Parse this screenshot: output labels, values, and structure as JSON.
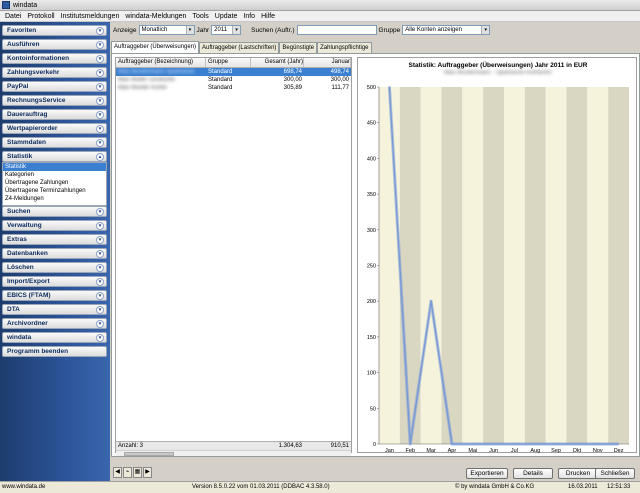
{
  "window": {
    "title": "windata"
  },
  "menu": [
    "Datei",
    "Protokoll",
    "Institutsmeldungen",
    "windata-Meldungen",
    "Tools",
    "Update",
    "Info",
    "Hilfe"
  ],
  "sidebar": {
    "items_top": [
      "Favoriten",
      "Ausführen",
      "Kontoinformationen",
      "Zahlungsverkehr",
      "PayPal",
      "RechnungsService",
      "Dauerauftrag",
      "Wertpapierorder",
      "Stammdaten",
      "Statistik"
    ],
    "statistik_sub": [
      "Statistik",
      "Kategorien",
      "Übertragene Zahlungen",
      "Übertragene Terminzahlungen",
      "Z4-Meldungen"
    ],
    "items_bottom": [
      "Suchen",
      "Verwaltung",
      "Extras",
      "Datenbanken",
      "Löschen",
      "Import/Export",
      "EBICS (FTAM)",
      "DTA",
      "Archivordner",
      "windata",
      "Programm beenden"
    ]
  },
  "filters": {
    "anzeige_label": "Anzeige",
    "anzeige_value": "Monatlich",
    "jahr_label": "Jahr",
    "jahr_value": "2011",
    "suchen_label": "Suchen (Auftr.)",
    "suchen_value": "",
    "gruppe_label": "Gruppe",
    "gruppe_value": "Alle Konten anzeigen"
  },
  "tabs": [
    "Auftraggeber (Überweisungen)",
    "Auftraggeber (Lastschriften)",
    "Begünstigte",
    "Zahlungspflichtige"
  ],
  "grid": {
    "columns": [
      "Auftraggeber (Bezeichnung)",
      "Gruppe",
      "Gesamt (Jahr)",
      "Januar"
    ],
    "rows": [
      {
        "name": "Max Mustermann Sparkasse",
        "gruppe": "Standard",
        "gesamt": "698,74",
        "januar": "498,74"
      },
      {
        "name": "Max Müller Girokonto",
        "gruppe": "Standard",
        "gesamt": "300,00",
        "januar": "300,00"
      },
      {
        "name": "Max Muster Konto",
        "gruppe": "Standard",
        "gesamt": "305,89",
        "januar": "111,77"
      }
    ],
    "footer": {
      "count_label": "Anzahl: 3",
      "gesamt": "1.304,63",
      "januar": "910,51"
    }
  },
  "chart_data": {
    "type": "line",
    "title": "Statistik: Auftraggeber (Überweisungen) Jahr 2011 in EUR",
    "subtitle": "Max Mustermann - Sparkasse KölnBonn",
    "categories": [
      "Jan",
      "Feb",
      "Mar",
      "Apr",
      "Mai",
      "Jun",
      "Jul",
      "Aug",
      "Sep",
      "Okt",
      "Nov",
      "Dez"
    ],
    "series": [
      {
        "values": [
          500,
          0,
          200,
          0,
          0,
          0,
          0,
          0,
          0,
          0,
          0,
          0
        ]
      }
    ],
    "ylim": [
      0,
      500
    ],
    "yticks": [
      0,
      50,
      100,
      150,
      200,
      250,
      300,
      350,
      400,
      450,
      500
    ],
    "colors": {
      "line": "#7a9ad6",
      "band_a": "#f5f3dc",
      "band_b": "#d9d6c2"
    }
  },
  "buttons": {
    "export": "Exportieren",
    "details": "Details",
    "print": "Drucken",
    "close": "Schließen"
  },
  "status": {
    "site": "www.windata.de",
    "version": "Version 8.5.0.22 vom 01.03.2011 (DDBAC 4.3.58.0)",
    "copyright": "© by windata GmbH & Co.KG",
    "date": "16.03.2011",
    "time": "12:51:33"
  }
}
